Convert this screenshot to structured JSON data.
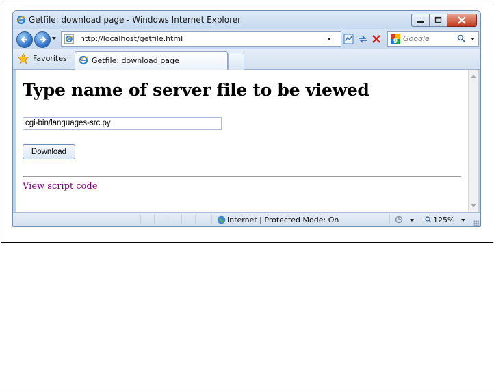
{
  "window": {
    "title": "Getfile: download page - Windows Internet Explorer"
  },
  "address_bar": {
    "url": "http://localhost/getfile.html"
  },
  "search": {
    "placeholder": "Google"
  },
  "favorites_bar": {
    "favorites_label": "Favorites",
    "tab_label": "Getfile: download page"
  },
  "page": {
    "heading": "Type name of server file to be viewed",
    "input_value": "cgi-bin/languages-src.py",
    "button_label": "Download",
    "link_text": "View script code",
    "link_color": "#800080"
  },
  "status_bar": {
    "zone_text": "Internet | Protected Mode: On",
    "zoom_text": "125%"
  },
  "icons": [
    "ie-icon",
    "back-arrow-icon",
    "forward-arrow-icon",
    "compatibility-view-icon",
    "refresh-icon",
    "stop-icon",
    "google-icon",
    "search-icon",
    "star-icon",
    "globe-icon",
    "minimize-icon",
    "maximize-icon",
    "close-icon"
  ]
}
